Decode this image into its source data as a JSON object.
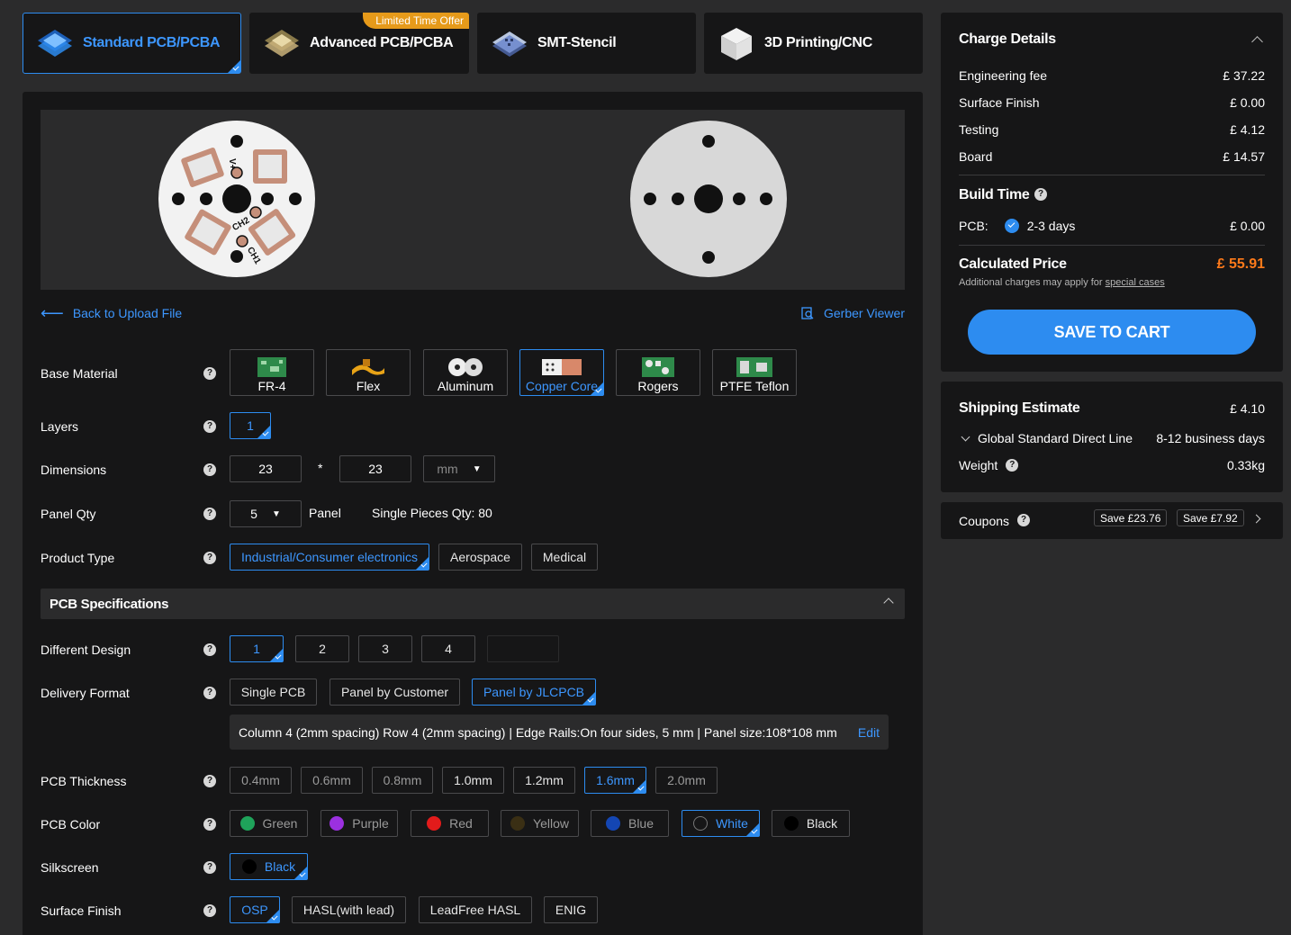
{
  "tabs": [
    {
      "label": "Standard PCB/PCBA",
      "icon": "pcb-stack-icon",
      "active": true
    },
    {
      "label": "Advanced PCB/PCBA",
      "icon": "advanced-pcb-icon",
      "badge": "Limited Time Offer"
    },
    {
      "label": "SMT-Stencil",
      "icon": "stencil-icon"
    },
    {
      "label": "3D Printing/CNC",
      "icon": "3d-cube-icon"
    }
  ],
  "preview": {
    "top_labels": [
      "V+",
      "CH2",
      "CH1"
    ]
  },
  "links": {
    "back": "Back to Upload File",
    "gerber": "Gerber Viewer"
  },
  "rows": {
    "base_material": "Base Material",
    "layers": "Layers",
    "dimensions": "Dimensions",
    "panel_qty": "Panel Qty",
    "product_type": "Product Type",
    "different_design": "Different Design",
    "delivery_format": "Delivery Format",
    "pcb_thickness": "PCB Thickness",
    "pcb_color": "PCB Color",
    "silkscreen": "Silkscreen",
    "surface_finish": "Surface Finish"
  },
  "materials": [
    "FR-4",
    "Flex",
    "Aluminum",
    "Copper Core",
    "Rogers",
    "PTFE Teflon"
  ],
  "layers": {
    "value": "1"
  },
  "dimensions": {
    "w": "23",
    "h": "23",
    "times": "*",
    "unit": "mm"
  },
  "panel_qty": {
    "value": "5",
    "suffix": "Panel",
    "pieces": "Single Pieces Qty: 80"
  },
  "product_types": [
    "Industrial/Consumer electronics",
    "Aerospace",
    "Medical"
  ],
  "pcb_spec_title": "PCB Specifications",
  "designs": [
    "1",
    "2",
    "3",
    "4"
  ],
  "delivery": [
    "Single PCB",
    "Panel by Customer",
    "Panel by JLCPCB"
  ],
  "panel_info": {
    "text": "Column 4 (2mm spacing) Row 4 (2mm spacing) | Edge Rails:On four sides, 5 mm | Panel size:108*108 mm",
    "edit": "Edit"
  },
  "thickness": [
    "0.4mm",
    "0.6mm",
    "0.8mm",
    "1.0mm",
    "1.2mm",
    "1.6mm",
    "2.0mm"
  ],
  "colors": [
    {
      "label": "Green",
      "hex": "#1fa35a"
    },
    {
      "label": "Purple",
      "hex": "#9b30e0"
    },
    {
      "label": "Red",
      "hex": "#e21b1b"
    },
    {
      "label": "Yellow",
      "hex": "#3a2f14"
    },
    {
      "label": "Blue",
      "hex": "#1446b3"
    },
    {
      "label": "White",
      "hex": "#161617"
    },
    {
      "label": "Black",
      "hex": "#000000"
    }
  ],
  "silkscreen": "Black",
  "finishes": [
    "OSP",
    "HASL(with lead)",
    "LeadFree HASL",
    "ENIG"
  ],
  "charge": {
    "title": "Charge Details",
    "items": [
      {
        "label": "Engineering fee",
        "value": "£ 37.22"
      },
      {
        "label": "Surface Finish",
        "value": "£ 0.00"
      },
      {
        "label": "Testing",
        "value": "£ 4.12"
      },
      {
        "label": "Board",
        "value": "£ 14.57"
      }
    ],
    "build_time": "Build Time",
    "pcb_label": "PCB:",
    "pcb_days": "2-3 days",
    "pcb_price": "£ 0.00",
    "calc_label": "Calculated Price",
    "calc_value": "£ 55.91",
    "note": "Additional charges may apply for",
    "note_link": "special cases",
    "cart": "SAVE TO CART"
  },
  "shipping": {
    "title": "Shipping Estimate",
    "price": "£ 4.10",
    "method": "Global Standard Direct Line",
    "days": "8-12 business days",
    "weight_label": "Weight",
    "weight": "0.33kg"
  },
  "coupons": {
    "label": "Coupons",
    "items": [
      "Save £23.76",
      "Save £7.92"
    ]
  },
  "colors_ui": {
    "accent": "#2d8cf0",
    "price": "#ff7a1a",
    "panel": "#161617",
    "bg": "#2b2b2c"
  }
}
